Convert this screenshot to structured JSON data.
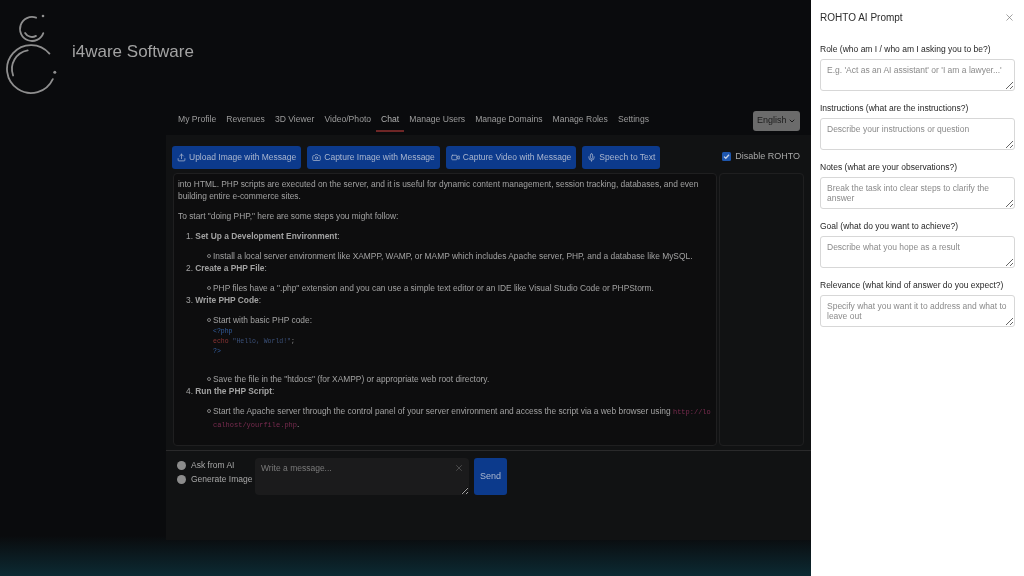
{
  "brand": {
    "name": "i4ware Software"
  },
  "nav": {
    "tabs": [
      {
        "label": "My Profile",
        "selected": false
      },
      {
        "label": "Revenues",
        "selected": false
      },
      {
        "label": "3D Viewer",
        "selected": false
      },
      {
        "label": "Video/Photo",
        "selected": false
      },
      {
        "label": "Chat",
        "selected": true
      },
      {
        "label": "Manage Users",
        "selected": false
      },
      {
        "label": "Manage Domains",
        "selected": false
      },
      {
        "label": "Manage Roles",
        "selected": false
      },
      {
        "label": "Settings",
        "selected": false
      }
    ],
    "language": {
      "value": "English"
    }
  },
  "toolbar": {
    "buttons": [
      {
        "kind": "upload",
        "label": "Upload Image with Message"
      },
      {
        "kind": "camera",
        "label": "Capture Image with Message"
      },
      {
        "kind": "video",
        "label": "Capture Video with Message"
      },
      {
        "kind": "mic",
        "label": "Speech to Text"
      }
    ],
    "disable_rohto": {
      "label": "Disable ROHTO",
      "checked": true
    }
  },
  "chat": {
    "blocks": [
      {
        "kind": "paragraph",
        "text": "into HTML. PHP scripts are executed on the server, and it is useful for dynamic content management, session tracking, databases, and even building entire e-commerce sites."
      },
      {
        "kind": "paragraph",
        "text": "To start \"doing PHP,\" here are some steps you might follow:"
      },
      {
        "kind": "ordered_list",
        "items": [
          {
            "heading": "1. **Set Up a Development Environment**:",
            "points": [
              {
                "text": "Install a local server environment like XAMPP, WAMP, or MAMP which includes Apache server, PHP, and a database like MySQL."
              }
            ]
          },
          {
            "heading": "2. **Create a PHP File**:",
            "points": [
              {
                "text": "PHP files have a \".php\" extension and you can use a simple text editor or an IDE like Visual Studio Code or PHPStorm."
              }
            ]
          },
          {
            "heading": "3. **Write PHP Code**:",
            "points": [
              {
                "text": "Start with basic PHP code:",
                "code_block": [
                  {
                    "tokens": [
                      {
                        "kind": "tag",
                        "text": "<?php"
                      }
                    ]
                  },
                  {
                    "tokens": [
                      {
                        "kind": "keyword",
                        "text": "echo "
                      },
                      {
                        "kind": "string",
                        "text": "\"Hello, World!\""
                      },
                      {
                        "kind": "punct",
                        "text": ";"
                      }
                    ]
                  },
                  {
                    "tokens": [
                      {
                        "kind": "tag",
                        "text": "?>"
                      }
                    ]
                  }
                ]
              },
              {
                "text": "Save the file in the \"htdocs\" (for XAMPP) or appropriate web root directory."
              }
            ]
          },
          {
            "heading": "4. **Run the PHP Script**:",
            "points": [
              {
                "text": "Start the Apache server through the control panel of your server environment and access the script via a web browser using ",
                "inline_code": "http://localhost/yourfile.php",
                "text_after": "."
              }
            ]
          }
        ]
      }
    ]
  },
  "composer": {
    "modes": [
      {
        "label": "Ask from AI",
        "selected": false
      },
      {
        "label": "Generate Image",
        "selected": false
      }
    ],
    "input": {
      "placeholder": "Write a message..."
    },
    "send": "Send"
  },
  "prompt_panel": {
    "title": "ROHTO AI Prompt",
    "fields": [
      {
        "label": "Role (who am I / who am I asking you to be?)",
        "placeholder": "E.g. 'Act as an AI assistant' or 'I am a lawyer...'"
      },
      {
        "label": "Instructions (what are the instructions?)",
        "placeholder": "Describe your instructions or question"
      },
      {
        "label": "Notes (what are your observations?)",
        "placeholder": "Break the task into clear steps to clarify the answer"
      },
      {
        "label": "Goal (what do you want to achieve?)",
        "placeholder": "Describe what you hope as a result"
      },
      {
        "label": "Relevance (what kind of answer do you expect?)",
        "placeholder": "Specify what you want it to address and what to leave out"
      }
    ]
  }
}
